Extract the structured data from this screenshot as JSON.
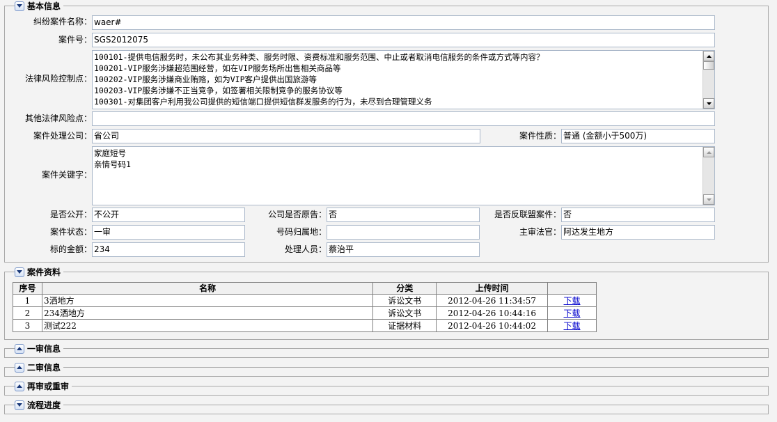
{
  "sections": {
    "basic": "基本信息",
    "files": "案件资料",
    "first": "一审信息",
    "second": "二审信息",
    "retrial": "再审或重审",
    "progress": "流程进度"
  },
  "form": {
    "case_name_label": "纠纷案件名称：",
    "case_name": "waer#",
    "case_no_label": "案件号：",
    "case_no": "SGS2012075",
    "risk_label": "法律风险控制点：",
    "risk_lines": [
      "100101-提供电信服务时，未公布其业务种类、服务时限、资费标准和服务范围、中止或者取消电信服务的条件或方式等内容？",
      "100201-VIP服务涉嫌超范围经营，如在VIP服务场所出售相关商品等",
      "100202-VIP服务涉嫌商业贿赂，如为VIP客户提供出国旅游等",
      "100203-VIP服务涉嫌不正当竞争，如签署相关限制竞争的服务协议等",
      "100301-对集团客户利用我公司提供的短信端口提供短信群发服务的行为，未尽到合理管理义务"
    ],
    "other_risk_label": "其他法律风险点：",
    "other_risk": "",
    "company_label": "案件处理公司：",
    "company": "省公司",
    "nature_label": "案件性质：",
    "nature": "普通 (金额小于500万)",
    "keywords_label": "案件关键字：",
    "keyword_lines": [
      "家庭短号",
      "亲情号码1"
    ],
    "public_label": "是否公开：",
    "public": "不公开",
    "plaintiff_label": "公司是否原告：",
    "plaintiff": "否",
    "antimonopoly_label": "是否反联盟案件：",
    "antimonopoly": "否",
    "status_label": "案件状态：",
    "status": "一审",
    "region_label": "号码归属地：",
    "region": "",
    "judge_label": "主审法官：",
    "judge": "阿达发生地方",
    "amount_label": "标的金额：",
    "amount": "234",
    "handler_label": "处理人员：",
    "handler": "蔡治平"
  },
  "files": {
    "headers": [
      "序号",
      "名称",
      "分类",
      "上传时间",
      ""
    ],
    "rows": [
      {
        "no": "1",
        "name": "3洒地方",
        "category": "诉讼文书",
        "time": "2012-04-26 11:34:57",
        "action": "下载"
      },
      {
        "no": "2",
        "name": "234洒地方",
        "category": "诉讼文书",
        "time": "2012-04-26 10:44:16",
        "action": "下载"
      },
      {
        "no": "3",
        "name": "测试222",
        "category": "证据材料",
        "time": "2012-04-26 10:44:02",
        "action": "下载"
      }
    ]
  },
  "icons": {
    "collapse": "chevron-up-icon",
    "expand": "chevron-down-icon"
  },
  "colors": {
    "background": "#f3f3f3",
    "border": "#a8a8a8",
    "link": "#0000cc"
  }
}
